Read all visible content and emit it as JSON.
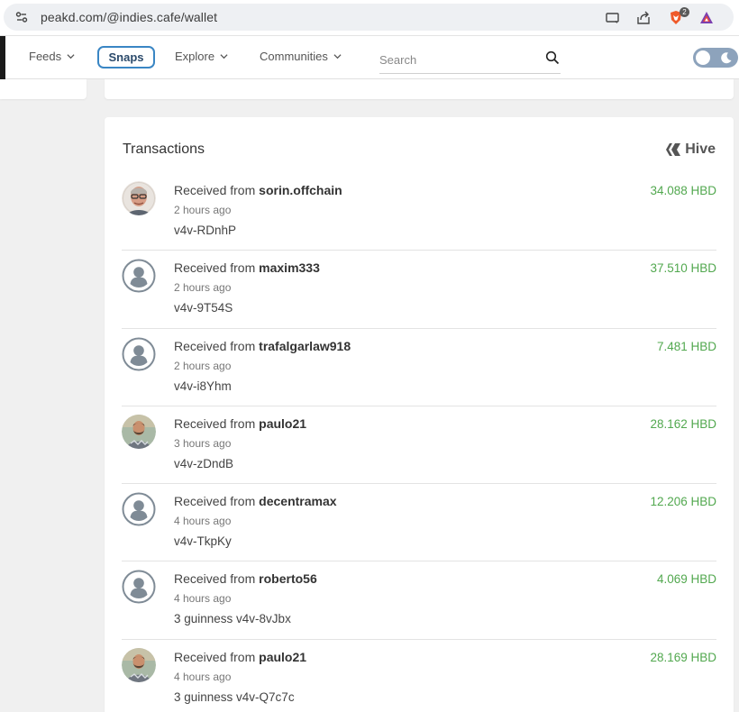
{
  "browser": {
    "url": "peakd.com/@indies.cafe/wallet",
    "brave_badge": "2"
  },
  "nav": {
    "feeds": "Feeds",
    "snaps": "Snaps",
    "explore": "Explore",
    "communities": "Communities",
    "search_placeholder": "Search"
  },
  "transactions": {
    "title": "Transactions",
    "currency_label": "Hive",
    "items": [
      {
        "prefix": "Received from",
        "user": "sorin.offchain",
        "time": "2 hours ago",
        "memo": "v4v-RDnhP",
        "amount": "34.088 HBD",
        "avatar": "photo-man-glasses"
      },
      {
        "prefix": "Received from",
        "user": "maxim333",
        "time": "2 hours ago",
        "memo": "v4v-9T54S",
        "amount": "37.510 HBD",
        "avatar": "default-user"
      },
      {
        "prefix": "Received from",
        "user": "trafalgarlaw918",
        "time": "2 hours ago",
        "memo": "v4v-i8Yhm",
        "amount": "7.481 HBD",
        "avatar": "default-user"
      },
      {
        "prefix": "Received from",
        "user": "paulo21",
        "time": "3 hours ago",
        "memo": "v4v-zDndB",
        "amount": "28.162 HBD",
        "avatar": "photo-man-beard"
      },
      {
        "prefix": "Received from",
        "user": "decentramax",
        "time": "4 hours ago",
        "memo": "v4v-TkpKy",
        "amount": "12.206 HBD",
        "avatar": "default-user"
      },
      {
        "prefix": "Received from",
        "user": "roberto56",
        "time": "4 hours ago",
        "memo": "3 guinness v4v-8vJbx",
        "amount": "4.069 HBD",
        "avatar": "default-user"
      },
      {
        "prefix": "Received from",
        "user": "paulo21",
        "time": "4 hours ago",
        "memo": "3 guinness v4v-Q7c7c",
        "amount": "28.169 HBD",
        "avatar": "photo-man-beard"
      }
    ]
  },
  "colors": {
    "amount_green": "#52a84f",
    "snaps_border": "#3a86c4",
    "toggle_bg": "#8da3bc"
  }
}
